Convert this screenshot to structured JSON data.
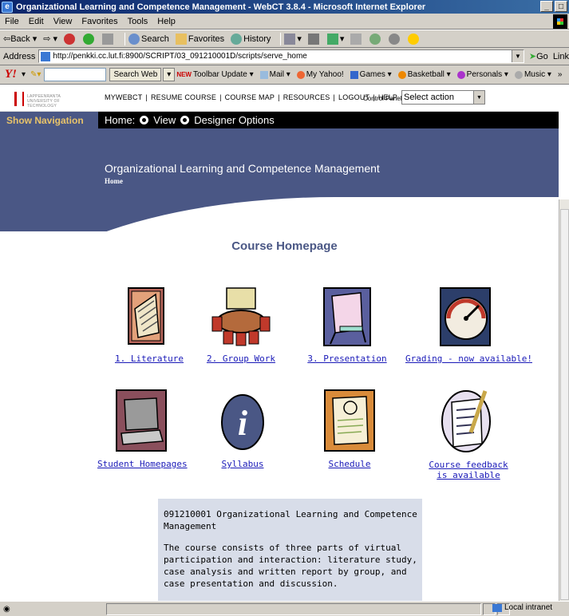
{
  "window": {
    "title": "Organizational Learning and Competence Management - WebCT 3.8.4 - Microsoft Internet Explorer",
    "min": "_",
    "max": "д"
  },
  "menu": [
    "File",
    "Edit",
    "View",
    "Favorites",
    "Tools",
    "Help"
  ],
  "toolbar": {
    "back": "⇦Back",
    "forward": "⇨",
    "search": "Search",
    "favorites": "Favorites",
    "history": "History"
  },
  "address": {
    "label": "Address",
    "url": "http://penkki.cc.lut.fi:8900/SCRIPT/03_091210001D/scripts/serve_home",
    "go": "Go",
    "links": "Link"
  },
  "yahoo": {
    "search_web": "Search Web",
    "new_badge": "NEW",
    "toolbar_update": "Toolbar Update",
    "mail": "Mail",
    "my_yahoo": "My Yahoo!",
    "games": "Games",
    "basketball": "Basketball",
    "personals": "Personals",
    "music": "Music",
    "more": "»"
  },
  "webct": {
    "logo_text": "LAPPEENRANTA UNIVERSITY OF TECHNOLOGY",
    "nav": [
      "MYWEBCT",
      "RESUME COURSE",
      "COURSE MAP",
      "RESOURCES",
      "LOGOUT",
      "HELP"
    ],
    "nav_sep": "|",
    "control_panel": "Control Panel",
    "select_action": "Select action",
    "show_navigation": "Show Navigation",
    "home_label": "Home:",
    "view_label": "View",
    "designer_label": "Designer Options",
    "course_title": "Organizational Learning and Competence Management",
    "breadcrumb": "Home",
    "page_heading": "Course Homepage"
  },
  "tiles": [
    {
      "label": "1. Literature",
      "icon": "book-icon"
    },
    {
      "label": "2. Group Work",
      "icon": "meeting-table-icon"
    },
    {
      "label": "3. Presentation",
      "icon": "presentation-easel-icon"
    },
    {
      "label": "Grading - now available!",
      "icon": "gauge-icon"
    },
    {
      "label": "Student Homepages",
      "icon": "laptop-icon"
    },
    {
      "label": "Syllabus",
      "icon": "info-icon"
    },
    {
      "label": "Schedule",
      "icon": "notebook-icon"
    },
    {
      "label": "Course feedback is available",
      "icon": "checklist-pen-icon"
    }
  ],
  "description": {
    "title": "091210001 Organizational Learning and Competence Management",
    "text": "The course consists of three parts of virtual participation and interaction: literature study, case analysis and written report by group, and case presentation and discussion."
  },
  "status": {
    "zone": "Local intranet"
  }
}
